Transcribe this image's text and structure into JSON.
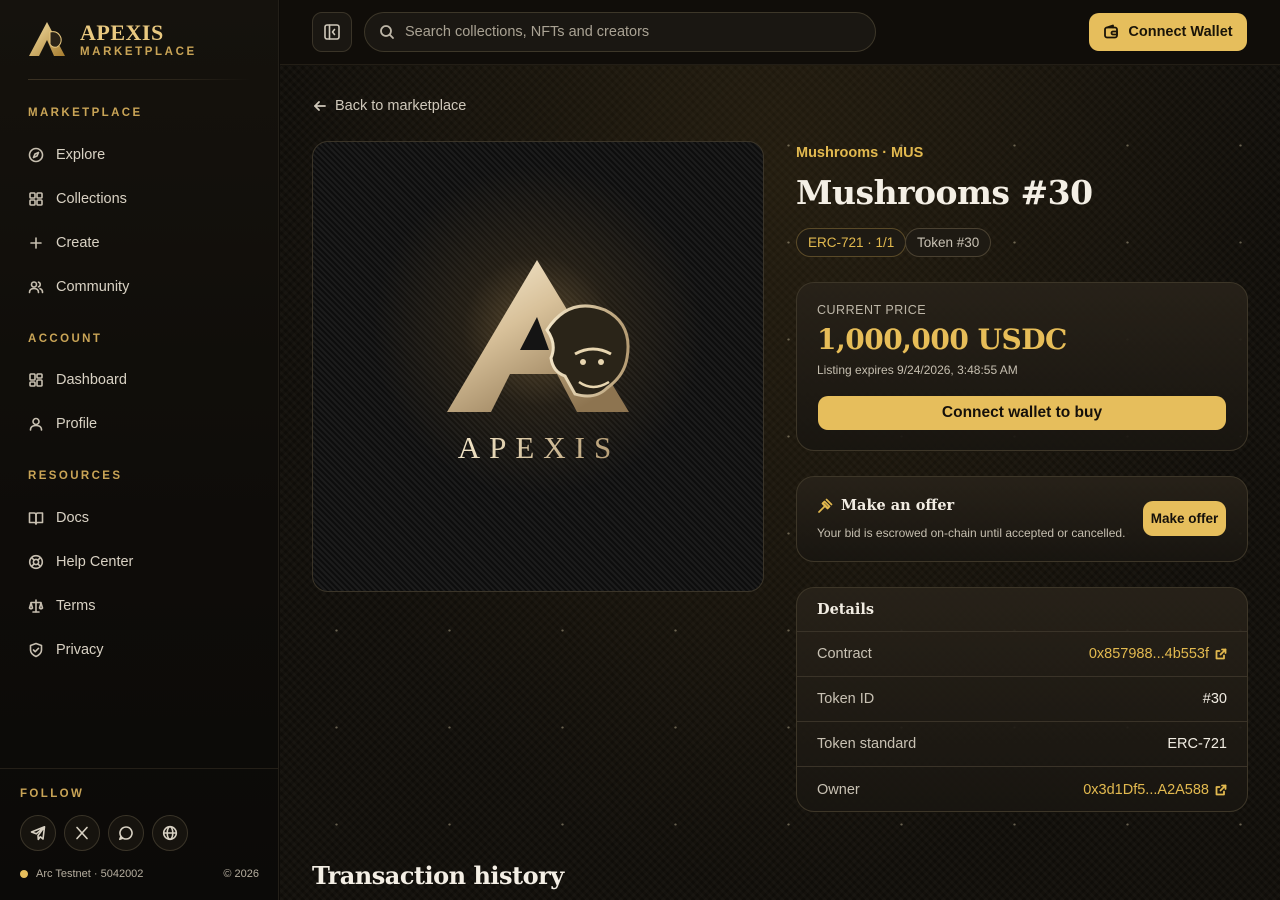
{
  "brand": {
    "name": "APEXIS",
    "sub": "MARKETPLACE",
    "art_text": "APEXIS"
  },
  "nav": {
    "sections": [
      {
        "title": "MARKETPLACE",
        "items": [
          {
            "label": "Explore",
            "icon": "compass-icon"
          },
          {
            "label": "Collections",
            "icon": "grid-icon"
          },
          {
            "label": "Create",
            "icon": "plus-icon"
          },
          {
            "label": "Community",
            "icon": "users-icon"
          }
        ]
      },
      {
        "title": "ACCOUNT",
        "items": [
          {
            "label": "Dashboard",
            "icon": "dashboard-icon"
          },
          {
            "label": "Profile",
            "icon": "user-icon"
          }
        ]
      },
      {
        "title": "RESOURCES",
        "items": [
          {
            "label": "Docs",
            "icon": "book-icon"
          },
          {
            "label": "Help Center",
            "icon": "lifebuoy-icon"
          },
          {
            "label": "Terms",
            "icon": "scale-icon"
          },
          {
            "label": "Privacy",
            "icon": "shield-icon"
          }
        ]
      }
    ]
  },
  "follow": {
    "label": "FOLLOW",
    "socials": [
      "telegram-icon",
      "x-icon",
      "chat-icon",
      "globe-icon"
    ],
    "network": "Arc Testnet · 5042002",
    "copyright": "© 2026"
  },
  "topbar": {
    "search_placeholder": "Search collections, NFTs and creators",
    "connect_label": "Connect Wallet"
  },
  "page": {
    "back_label": "Back to marketplace",
    "collection": "Mushrooms · MUS",
    "title": "Mushrooms #30",
    "badges": [
      "ERC-721 · 1/1",
      "Token #30"
    ]
  },
  "price": {
    "label": "CURRENT PRICE",
    "value": "1,000,000 USDC",
    "expires": "Listing expires 9/24/2026, 3:48:55 AM",
    "buy_label": "Connect wallet to buy"
  },
  "offer": {
    "title": "Make an offer",
    "desc": "Your bid is escrowed on-chain until accepted or cancelled.",
    "button": "Make offer"
  },
  "details": {
    "title": "Details",
    "rows": [
      {
        "label": "Contract",
        "value": "0x857988...4b553f"
      },
      {
        "label": "Token ID",
        "value": "#30"
      },
      {
        "label": "Token standard",
        "value": "ERC-721"
      },
      {
        "label": "Owner",
        "value": "0x3d1Df5...A2A588"
      }
    ]
  },
  "tx_title": "Transaction history",
  "colors": {
    "accent": "#e6be5c",
    "gold_text": "#e2b94f",
    "background": "#0c0a07"
  }
}
